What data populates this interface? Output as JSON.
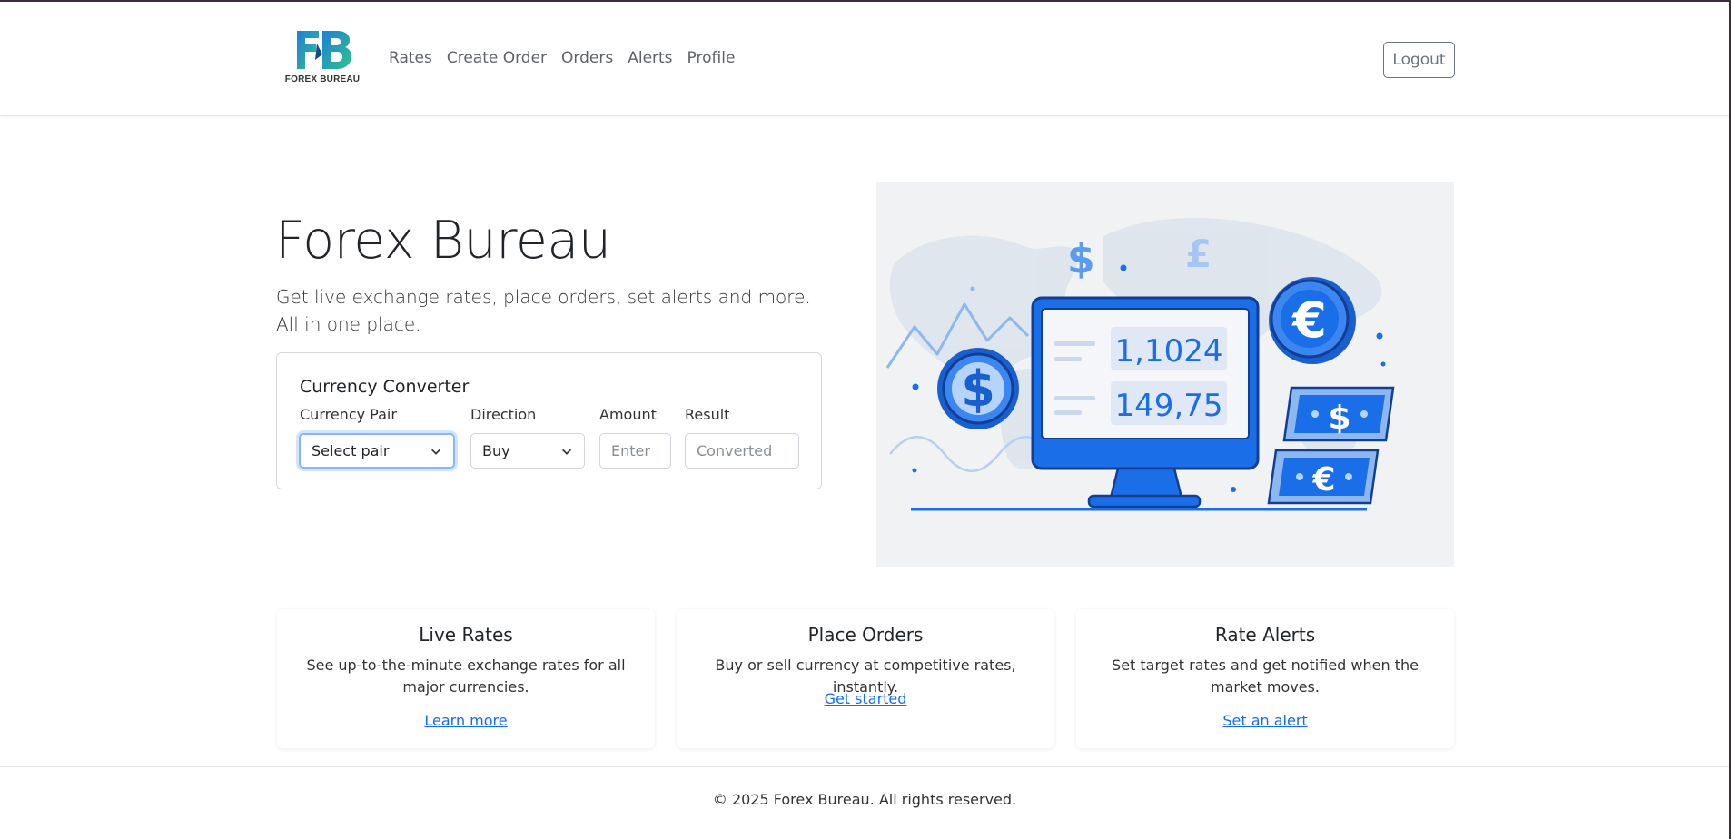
{
  "brand": {
    "logo_letters": "FB",
    "logo_text": "FOREX BUREAU"
  },
  "nav": {
    "links": [
      "Rates",
      "Create Order",
      "Orders",
      "Alerts",
      "Profile"
    ],
    "logout_label": "Logout"
  },
  "hero": {
    "title": "Forex Bureau",
    "subtitle": "Get live exchange rates, place orders, set alerts and more. All in one place."
  },
  "converter": {
    "title": "Currency Converter",
    "pair_label": "Currency Pair",
    "pair_value": "Select pair",
    "direction_label": "Direction",
    "direction_value": "Buy",
    "amount_label": "Amount",
    "amount_placeholder": "Enter",
    "result_label": "Result",
    "result_placeholder": "Converted"
  },
  "illustration": {
    "rate_1": "1,1024",
    "rate_2": "149,75",
    "symbols": [
      "$",
      "£",
      "€"
    ]
  },
  "cards": [
    {
      "title": "Live Rates",
      "text": "See up-to-the-minute exchange rates for all major currencies.",
      "link": "Learn more"
    },
    {
      "title": "Place Orders",
      "text": "Buy or sell currency at competitive rates, instantly.",
      "link": "Get started"
    },
    {
      "title": "Rate Alerts",
      "text": "Set target rates and get notified when the market moves.",
      "link": "Set an alert"
    }
  ],
  "footer": {
    "text": "© 2025 Forex Bureau. All rights reserved."
  },
  "colors": {
    "primary_blue": "#1a6ee8",
    "link_blue": "#0d6efd",
    "logo_green": "#2dbf7a"
  }
}
